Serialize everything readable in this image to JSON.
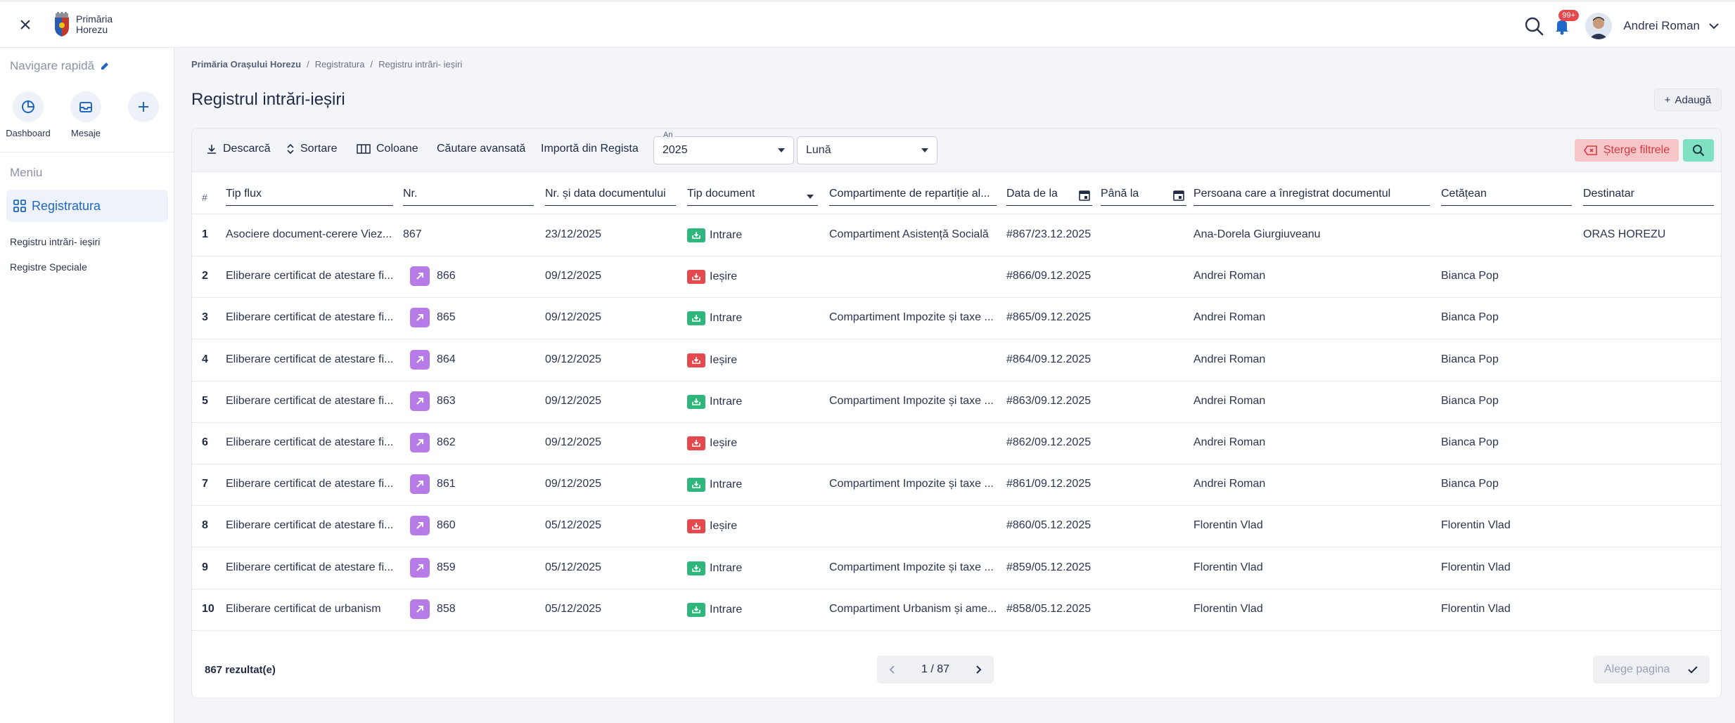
{
  "header": {
    "logo_line1": "Primăria",
    "logo_line2": "Horezu",
    "notification_badge": "99+",
    "user_name": "Andrei Roman"
  },
  "sidebar": {
    "quick_nav": "Navigare rapidă",
    "shortcuts": [
      {
        "label": "Dashboard"
      },
      {
        "label": "Mesaje"
      }
    ],
    "menu_title": "Meniu",
    "active_item": "Registratura",
    "links": [
      "Registru intrări- ieșiri",
      "Registre Speciale"
    ]
  },
  "breadcrumb": [
    "Primăria Orașului Horezu",
    "Registratura",
    "Registru intrări- ieșiri"
  ],
  "page_title": "Registrul intrări-ieșiri",
  "add_label": "Adaugă",
  "toolbar": {
    "download": "Descarcă",
    "sort": "Sortare",
    "columns": "Coloane",
    "advanced_search": "Căutare avansată",
    "import": "Importă din Regista",
    "year_label": "An",
    "year_value": "2025",
    "month_value": "Lună",
    "clear_filters": "Șterge filtrele"
  },
  "colors": {
    "accent": "#2167c7",
    "intrare": "#2fb67c",
    "iesire": "#e5484d",
    "arrow": "#b77be8"
  },
  "table": {
    "headers": {
      "hash": "#",
      "tip_flux": "Tip flux",
      "nr": "Nr.",
      "nr_data": "Nr. și data documentului",
      "tip_document": "Tip document",
      "compartimente": "Compartimente de repartiție al...",
      "data_de_la": "Data de la",
      "pana_la": "Până la",
      "persoana": "Persoana care a înregistrat documentul",
      "cetatean": "Cetățean",
      "destinatar": "Destinatar"
    },
    "rows": [
      {
        "n": "1",
        "flux": "Asociere document-cerere Viez...",
        "nr": "867",
        "data": "23/12/2025",
        "tip": "Intrare",
        "comp": "Compartiment Asistență Socială",
        "ref": "#867/23.12.2025",
        "pers": "Ana-Dorela Giurgiuveanu",
        "cet": "",
        "dest": "ORAS HOREZU",
        "arrow": false
      },
      {
        "n": "2",
        "flux": "Eliberare certificat de atestare fi...",
        "nr": "866",
        "data": "09/12/2025",
        "tip": "Ieșire",
        "comp": "",
        "ref": "#866/09.12.2025",
        "pers": "Andrei Roman",
        "cet": "Bianca Pop",
        "dest": "",
        "arrow": true
      },
      {
        "n": "3",
        "flux": "Eliberare certificat de atestare fi...",
        "nr": "865",
        "data": "09/12/2025",
        "tip": "Intrare",
        "comp": "Compartiment Impozite și taxe ...",
        "ref": "#865/09.12.2025",
        "pers": "Andrei Roman",
        "cet": "Bianca Pop",
        "dest": "",
        "arrow": true
      },
      {
        "n": "4",
        "flux": "Eliberare certificat de atestare fi...",
        "nr": "864",
        "data": "09/12/2025",
        "tip": "Ieșire",
        "comp": "",
        "ref": "#864/09.12.2025",
        "pers": "Andrei Roman",
        "cet": "Bianca Pop",
        "dest": "",
        "arrow": true
      },
      {
        "n": "5",
        "flux": "Eliberare certificat de atestare fi...",
        "nr": "863",
        "data": "09/12/2025",
        "tip": "Intrare",
        "comp": "Compartiment Impozite și taxe ...",
        "ref": "#863/09.12.2025",
        "pers": "Andrei Roman",
        "cet": "Bianca Pop",
        "dest": "",
        "arrow": true
      },
      {
        "n": "6",
        "flux": "Eliberare certificat de atestare fi...",
        "nr": "862",
        "data": "09/12/2025",
        "tip": "Ieșire",
        "comp": "",
        "ref": "#862/09.12.2025",
        "pers": "Andrei Roman",
        "cet": "Bianca Pop",
        "dest": "",
        "arrow": true
      },
      {
        "n": "7",
        "flux": "Eliberare certificat de atestare fi...",
        "nr": "861",
        "data": "09/12/2025",
        "tip": "Intrare",
        "comp": "Compartiment Impozite și taxe ...",
        "ref": "#861/09.12.2025",
        "pers": "Andrei Roman",
        "cet": "Bianca Pop",
        "dest": "",
        "arrow": true
      },
      {
        "n": "8",
        "flux": "Eliberare certificat de atestare fi...",
        "nr": "860",
        "data": "05/12/2025",
        "tip": "Ieșire",
        "comp": "",
        "ref": "#860/05.12.2025",
        "pers": "Florentin Vlad",
        "cet": "Florentin Vlad",
        "dest": "",
        "arrow": true
      },
      {
        "n": "9",
        "flux": "Eliberare certificat de atestare fi...",
        "nr": "859",
        "data": "05/12/2025",
        "tip": "Intrare",
        "comp": "Compartiment Impozite și taxe ...",
        "ref": "#859/05.12.2025",
        "pers": "Florentin Vlad",
        "cet": "Florentin Vlad",
        "dest": "",
        "arrow": true
      },
      {
        "n": "10",
        "flux": "Eliberare certificat de urbanism",
        "nr": "858",
        "data": "05/12/2025",
        "tip": "Intrare",
        "comp": "Compartiment Urbanism și ame...",
        "ref": "#858/05.12.2025",
        "pers": "Florentin Vlad",
        "cet": "Florentin Vlad",
        "dest": "",
        "arrow": true
      }
    ]
  },
  "footer": {
    "results": "867 rezultat(e)",
    "page": "1 / 87",
    "pick_page": "Alege pagina"
  }
}
